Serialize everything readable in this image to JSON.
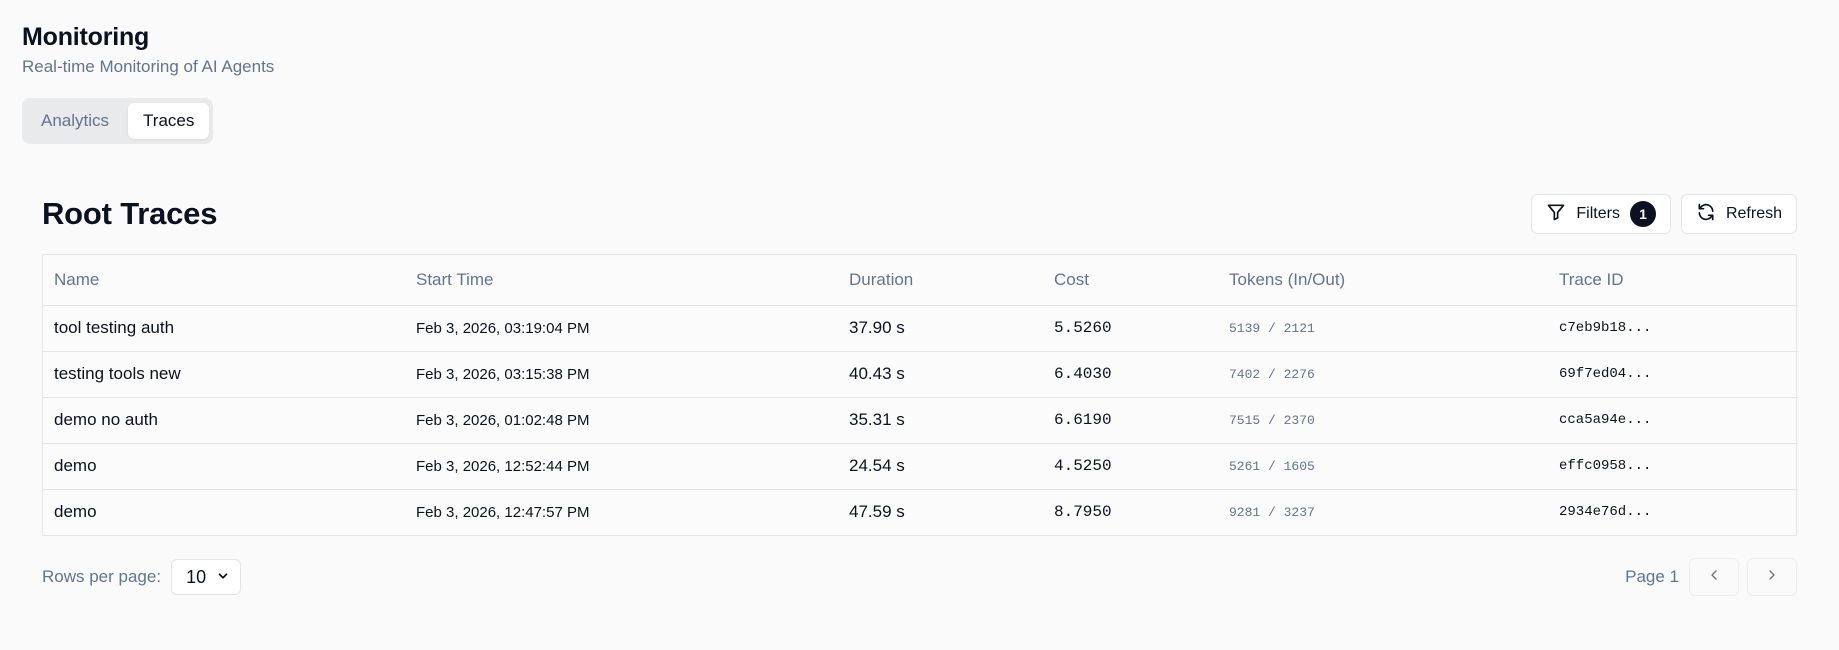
{
  "header": {
    "title": "Monitoring",
    "subtitle": "Real-time Monitoring of AI Agents"
  },
  "tabs": [
    {
      "label": "Analytics",
      "active": false
    },
    {
      "label": "Traces",
      "active": true
    }
  ],
  "panel": {
    "title": "Root Traces",
    "filters_label": "Filters",
    "filters_count": "1",
    "refresh_label": "Refresh"
  },
  "table": {
    "columns": [
      "Name",
      "Start Time",
      "Duration",
      "Cost",
      "Tokens (In/Out)",
      "Trace ID"
    ],
    "rows": [
      {
        "name": "tool testing auth",
        "start": "Feb 3, 2026, 03:19:04 PM",
        "duration": "37.90 s",
        "cost": "5.5260",
        "tokens": "5139 / 2121",
        "trace_id": "c7eb9b18..."
      },
      {
        "name": "testing tools new",
        "start": "Feb 3, 2026, 03:15:38 PM",
        "duration": "40.43 s",
        "cost": "6.4030",
        "tokens": "7402 / 2276",
        "trace_id": "69f7ed04..."
      },
      {
        "name": "demo no auth",
        "start": "Feb 3, 2026, 01:02:48 PM",
        "duration": "35.31 s",
        "cost": "6.6190",
        "tokens": "7515 / 2370",
        "trace_id": "cca5a94e..."
      },
      {
        "name": "demo",
        "start": "Feb 3, 2026, 12:52:44 PM",
        "duration": "24.54 s",
        "cost": "4.5250",
        "tokens": "5261 / 1605",
        "trace_id": "effc0958..."
      },
      {
        "name": "demo",
        "start": "Feb 3, 2026, 12:47:57 PM",
        "duration": "47.59 s",
        "cost": "8.7950",
        "tokens": "9281 / 3237",
        "trace_id": "2934e76d..."
      }
    ]
  },
  "footer": {
    "rows_per_page_label": "Rows per page:",
    "rows_per_page_value": "10",
    "page_label": "Page 1"
  },
  "icons": {
    "filter": "filter-icon",
    "refresh": "refresh-icon",
    "chevron_down": "chevron-down-icon",
    "prev": "chevron-left-icon",
    "next": "chevron-right-icon"
  },
  "colors": {
    "background": "#fafafa",
    "text_primary": "#0b1120",
    "text_muted": "#64748b",
    "border": "#e3e5e8",
    "badge": "#0b1120"
  }
}
